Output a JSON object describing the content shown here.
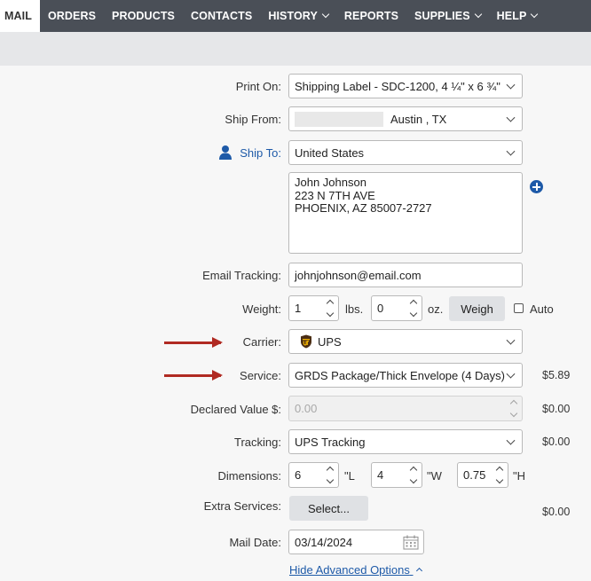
{
  "nav": {
    "items": [
      {
        "label": "MAIL",
        "dropdown": false
      },
      {
        "label": "ORDERS",
        "dropdown": false
      },
      {
        "label": "PRODUCTS",
        "dropdown": false
      },
      {
        "label": "CONTACTS",
        "dropdown": false
      },
      {
        "label": "HISTORY",
        "dropdown": true
      },
      {
        "label": "REPORTS",
        "dropdown": false
      },
      {
        "label": "SUPPLIES",
        "dropdown": true
      },
      {
        "label": "HELP",
        "dropdown": true
      }
    ],
    "active": "MAIL"
  },
  "form": {
    "print_on": {
      "label": "Print On:",
      "value": "Shipping Label - SDC-1200, 4 ¼\" x 6 ¾\""
    },
    "ship_from": {
      "label": "Ship From:",
      "value": "Austin , TX"
    },
    "ship_to": {
      "label": "Ship To:",
      "country": "United States",
      "address": "John Johnson\n223 N 7TH AVE\nPHOENIX, AZ 85007-2727"
    },
    "email": {
      "label": "Email Tracking:",
      "value": "johnjohnson@email.com"
    },
    "weight": {
      "label": "Weight:",
      "lbs": "1",
      "lbs_unit": "lbs.",
      "oz": "0",
      "oz_unit": "oz.",
      "weigh_button": "Weigh",
      "auto_label": "Auto",
      "auto_checked": false
    },
    "carrier": {
      "label": "Carrier:",
      "value": "UPS"
    },
    "service": {
      "label": "Service:",
      "value": "GRDS Package/Thick Envelope (4 Days)",
      "price": "$5.89"
    },
    "declared_value": {
      "label": "Declared Value $:",
      "placeholder": "0.00",
      "price": "$0.00"
    },
    "tracking": {
      "label": "Tracking:",
      "value": "UPS Tracking",
      "price": "$0.00"
    },
    "dimensions": {
      "label": "Dimensions:",
      "length": "6",
      "length_unit": "\"L",
      "width": "4",
      "width_unit": "\"W",
      "height": "0.75",
      "height_unit": "\"H"
    },
    "extra_services": {
      "label": "Extra Services:",
      "button": "Select...",
      "price": "$0.00"
    },
    "mail_date": {
      "label": "Mail Date:",
      "value": "03/14/2024"
    },
    "advanced_link": "Hide Advanced Options"
  },
  "colors": {
    "nav_bg": "#4a4f57",
    "link": "#1e5aa8",
    "arrow": "#b02a22",
    "ups_brown": "#4b2e14",
    "ups_gold": "#f2b300"
  }
}
